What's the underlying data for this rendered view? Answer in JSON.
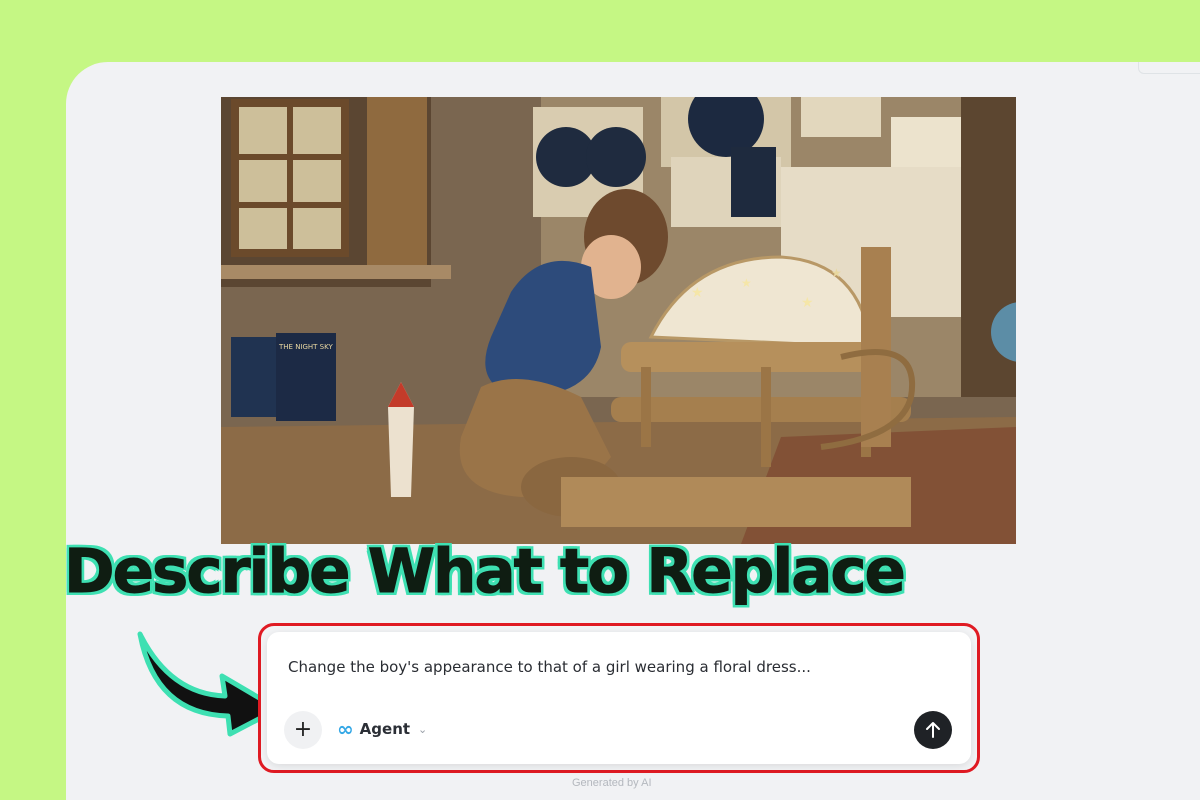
{
  "headline": "Describe What to Replace",
  "prompt": {
    "text": "Change the boy's appearance to that of a girl wearing a floral dress..."
  },
  "toolbar": {
    "add_label": "+",
    "agent_icon": "∞",
    "agent_label": "Agent",
    "chevron": "⌄"
  },
  "footer": {
    "note": "Generated by AI"
  },
  "image": {
    "book_title": "THE NIGHT SKY",
    "icon": "image"
  },
  "colors": {
    "page_bg": "#c5f784",
    "highlight_border": "#e01b23",
    "headline_outline": "#3ee0b2",
    "agent_icon": "#35a8e6",
    "send_button": "#1f2226"
  }
}
